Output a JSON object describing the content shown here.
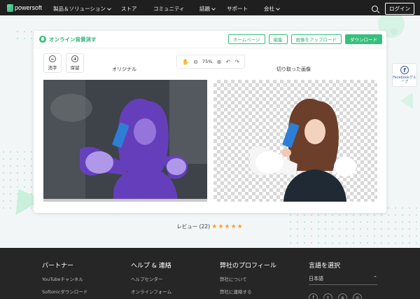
{
  "brand": {
    "name": "powersoft",
    "accent": "#36c07c"
  },
  "nav": {
    "items": [
      {
        "label": "製品＆ソリューション",
        "has_caret": true
      },
      {
        "label": "ストア",
        "has_caret": false
      },
      {
        "label": "コミュニティ",
        "has_caret": false
      },
      {
        "label": "話題",
        "has_caret": true
      },
      {
        "label": "サポート",
        "has_caret": false
      },
      {
        "label": "会社",
        "has_caret": true
      }
    ],
    "login_label": "ログイン"
  },
  "app": {
    "title": "オンライン背景消す",
    "buttons": {
      "home": "ホームページ",
      "edit": "編集",
      "upload": "画像をアップロード",
      "download": "ダウンロード"
    },
    "tools": {
      "clear": "消字",
      "save": "保留"
    },
    "zoom": "75%",
    "labels": {
      "original": "オリジナル",
      "cutout": "切り取った画像"
    }
  },
  "side_widget": {
    "label": "Facebookグループ"
  },
  "reviews": {
    "label": "レビュー (22)",
    "rating": 5
  },
  "footer": {
    "partner": {
      "heading": "パートナー",
      "links": [
        "YouTubeチャンネル",
        "Softonicダウンロード"
      ]
    },
    "help": {
      "heading": "ヘルプ & 連絡",
      "links": [
        "ヘルプセンター",
        "オンラインフォーム"
      ]
    },
    "company": {
      "heading": "弊社のプロフィール",
      "links": [
        "弊社について",
        "弊社に連絡する"
      ]
    },
    "language": {
      "heading": "言語を選択",
      "selected": "日本語"
    }
  }
}
